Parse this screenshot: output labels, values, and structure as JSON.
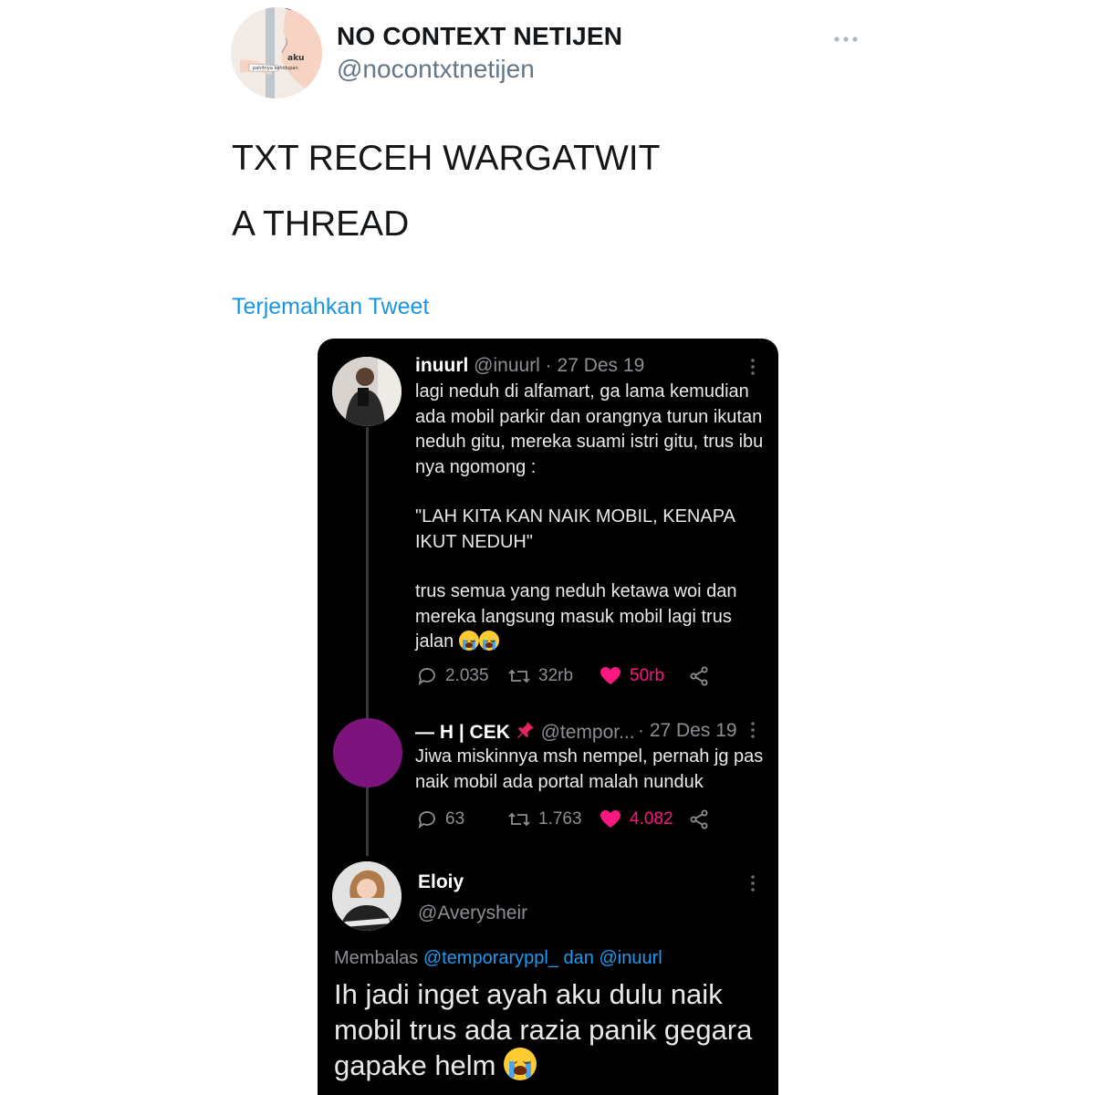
{
  "outer_tweet": {
    "display_name": "NO CONTEXT NETIJEN",
    "handle": "@nocontxtnetijen",
    "more_icon": "more-horizontal-icon",
    "avatar_caption_1": "aku",
    "avatar_caption_2": "pahitnya kehidupan",
    "text_lines": [
      "TXT RECEH WARGATWIT",
      "A THREAD"
    ],
    "translate_link": "Terjemahkan Tweet"
  },
  "embedded": {
    "tweets": [
      {
        "name": "inuurl",
        "handle_date": "@inuurl · 27 Des 19",
        "text": [
          "lagi neduh di alfamart, ga lama kemudian ada mobil parkir dan orangnya turun ikutan neduh gitu, mereka suami istri gitu, trus ibu nya ngomong :",
          "\"LAH KITA KAN NAIK MOBIL, KENAPA IKUT NEDUH\"",
          "trus semua yang neduh ketawa woi dan mereka langsung masuk mobil lagi trus jalan"
        ],
        "replies": "2.035",
        "retweets": "32rb",
        "likes": "50rb"
      },
      {
        "name": "— H | CEK",
        "pin_icon": "pushpin-icon",
        "handle": "@tempor...",
        "date": "· 27 Des 19",
        "text": "Jiwa miskinnya msh nempel, pernah jg pas naik mobil ada portal malah nunduk",
        "replies": "63",
        "retweets": "1.763",
        "likes": "4.082"
      },
      {
        "name": "Eloiy",
        "handle": "@Averysheir",
        "reply_prefix": "Membalas",
        "reply_mention_1": "@temporaryppl_",
        "reply_join": "dan",
        "reply_mention_2": "@inuurl",
        "text": "Ih jadi inget ayah aku dulu naik mobil trus ada razia panik gegara gapake helm"
      }
    ]
  },
  "colors": {
    "link_blue": "#1b95e0",
    "like_pink": "#f91880",
    "dark_bg": "#000000"
  }
}
